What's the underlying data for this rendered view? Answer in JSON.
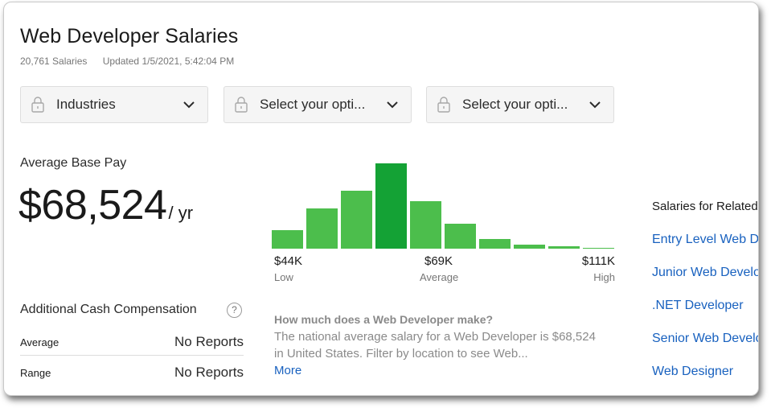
{
  "page": {
    "title": "Web Developer Salaries",
    "salary_count": "20,761 Salaries",
    "updated": "Updated 1/5/2021, 5:42:04 PM"
  },
  "filters": [
    {
      "label": "Industries",
      "icon": "lock-icon"
    },
    {
      "label": "Select your opti...",
      "icon": "lock-icon"
    },
    {
      "label": "Select your opti...",
      "icon": "lock-icon"
    }
  ],
  "pay": {
    "label": "Average Base Pay",
    "amount": "$68,524",
    "unit": "/ yr"
  },
  "histogram": {
    "relative_heights": [
      0.22,
      0.47,
      0.68,
      1.0,
      0.56,
      0.29,
      0.11,
      0.05,
      0.025,
      0.01
    ],
    "highlight_index": 3,
    "colors": {
      "bar": "#4cbe4c",
      "highlight": "#14a235"
    },
    "low": {
      "value": "$44K",
      "label": "Low"
    },
    "average": {
      "value": "$69K",
      "label": "Average"
    },
    "high": {
      "value": "$111K",
      "label": "High"
    }
  },
  "additional_comp": {
    "title": "Additional Cash Compensation",
    "help_glyph": "?",
    "rows": [
      {
        "key": "Average",
        "value": "No Reports"
      },
      {
        "key": "Range",
        "value": "No Reports"
      }
    ]
  },
  "faq": {
    "question": "How much does a Web Developer make?",
    "answer": "The national average salary for a Web Developer is $68,524 in United States. Filter by location to see Web...",
    "more": "More"
  },
  "related": {
    "title": "Salaries for Related Job Titles",
    "links": [
      "Entry Level Web Developer",
      "Junior Web Developer",
      ".NET Developer",
      "Senior Web Developer",
      "Web Designer"
    ]
  },
  "colors": {
    "link": "#1861bf",
    "muted": "#767676"
  }
}
